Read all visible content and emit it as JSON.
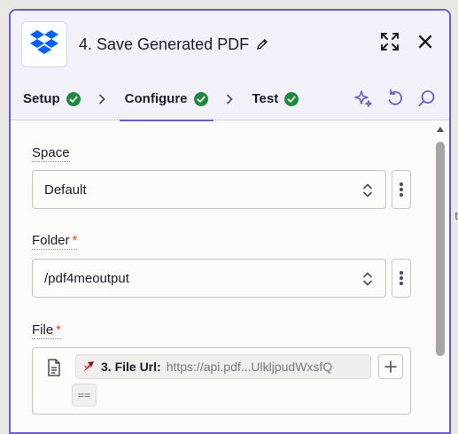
{
  "header": {
    "title": "4. Save Generated PDF",
    "app_icon": "dropbox-logo",
    "edit_icon": "pencil-icon",
    "expand_icon": "expand-icon",
    "close_icon": "close-icon"
  },
  "tabs": [
    {
      "label": "Setup",
      "status": "complete"
    },
    {
      "label": "Configure",
      "status": "complete",
      "active": true
    },
    {
      "label": "Test",
      "status": "complete"
    }
  ],
  "tools": [
    "sparkle-ai-icon",
    "undo-icon",
    "search-icon"
  ],
  "background_hint": "t",
  "fields": {
    "space": {
      "label": "Space",
      "value": "Default",
      "required": false
    },
    "folder": {
      "label": "Folder",
      "value": "/pdf4meoutput",
      "required": true,
      "required_mark": "*"
    },
    "file": {
      "label": "File",
      "required": true,
      "required_mark": "*",
      "token_label": "3. File Url:",
      "token_value": "https://api.pdf...UlkljpudWxsfQ",
      "token_cont": "=="
    }
  },
  "colors": {
    "accent": "#6b5cc9",
    "success": "#1e8a3c",
    "required": "#d94a2b",
    "dropbox": "#0061fe"
  }
}
